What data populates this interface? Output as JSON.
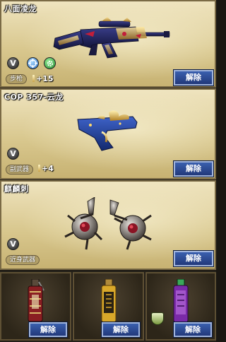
{
  "panels": [
    {
      "title": "八面凌龙",
      "category": "步枪",
      "bonus": "+15",
      "button": "解除"
    },
    {
      "title": "COP 357-云龙",
      "category": "副武器",
      "bonus": "+4",
      "button": "解除"
    },
    {
      "title": "麒麟刺",
      "category": "近身武器",
      "button": "解除"
    }
  ],
  "badge_v": "V",
  "slots": [
    {
      "button": "解除"
    },
    {
      "button": "解除"
    },
    {
      "button": "解除"
    }
  ],
  "colors": {
    "panel_bg": "#d9c88f",
    "button_bg": "#2d4a94",
    "button_border": "#9fb3dc"
  }
}
